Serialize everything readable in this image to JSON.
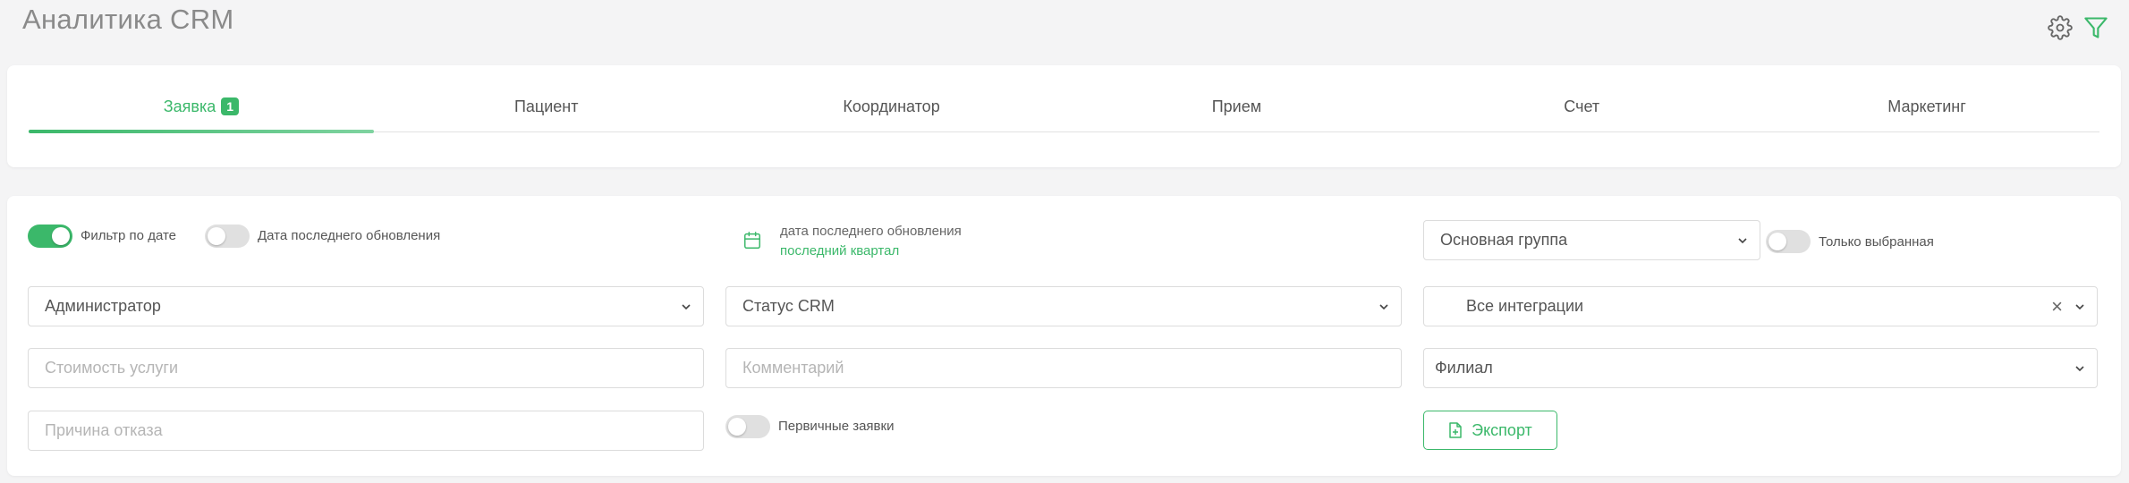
{
  "header": {
    "title": "Аналитика CRM",
    "settings_icon": "gear-icon",
    "filter_icon": "filter-icon"
  },
  "tabs": [
    {
      "label": "Заявка",
      "badge": "1",
      "active": true
    },
    {
      "label": "Пациент"
    },
    {
      "label": "Координатор"
    },
    {
      "label": "Прием"
    },
    {
      "label": "Счет"
    },
    {
      "label": "Маркетинг"
    }
  ],
  "filters": {
    "date_filter": {
      "label": "Фильтр по дате",
      "on": true
    },
    "last_update_toggle": {
      "label": "Дата последнего обновления",
      "on": false
    },
    "date_range": {
      "label": "дата последнего обновления",
      "value": "последний квартал"
    },
    "group_select": {
      "value": "Основная группа"
    },
    "only_selected": {
      "label": "Только выбранная",
      "on": false
    },
    "administrator": {
      "value": "Администратор"
    },
    "crm_status": {
      "value": "Статус CRM"
    },
    "integrations": {
      "value": "Все интеграции",
      "clear": "×"
    },
    "service_cost": {
      "placeholder": "Стоимость услуги"
    },
    "comment": {
      "placeholder": "Комментарий"
    },
    "branch": {
      "value": "Филиал"
    },
    "refusal_reason": {
      "placeholder": "Причина отказа"
    },
    "primary_requests": {
      "label": "Первичные заявки",
      "on": false
    },
    "export_button": {
      "label": "Экспорт"
    }
  },
  "colors": {
    "accent": "#3bb86a",
    "background": "#f4f4f5",
    "card": "#ffffff"
  }
}
